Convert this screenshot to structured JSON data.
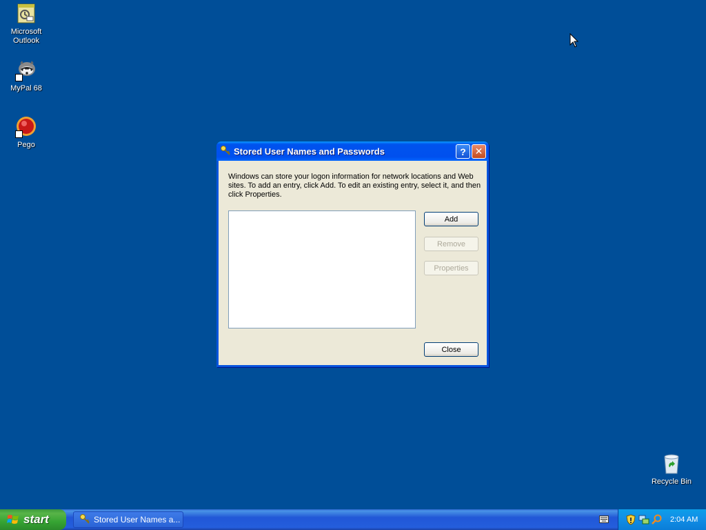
{
  "desktop": {
    "icons": [
      {
        "label": "Microsoft\nOutlook",
        "icon": "outlook-icon"
      },
      {
        "label": "MyPal 68",
        "icon": "raccoon-icon"
      },
      {
        "label": "Pego",
        "icon": "pego-icon"
      }
    ],
    "recycle_bin": {
      "label": "Recycle Bin",
      "icon": "recycle-bin-icon"
    }
  },
  "dialog": {
    "title": "Stored User Names and Passwords",
    "description": "Windows can store your logon information for network locations and Web sites. To add an entry, click Add. To edit an existing entry, select it, and then click Properties.",
    "buttons": {
      "add": "Add",
      "remove": "Remove",
      "properties": "Properties",
      "close": "Close"
    },
    "help_glyph": "?",
    "close_glyph": "✕"
  },
  "taskbar": {
    "start_label": "start",
    "task_label": "Stored User Names a...",
    "clock": "2:04 AM"
  },
  "colors": {
    "desktop": "#004e98",
    "dialog_face": "#ece9d8",
    "titlebar": "#0053ee"
  }
}
